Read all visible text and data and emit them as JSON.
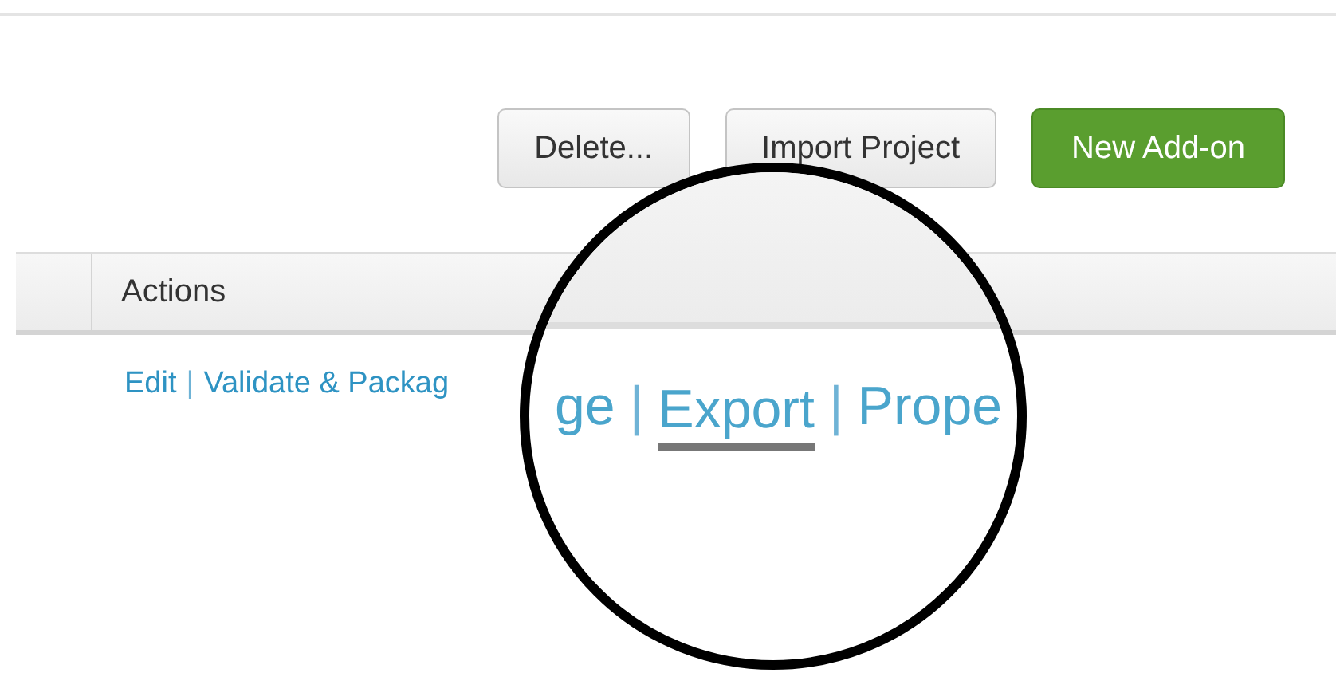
{
  "toolbar": {
    "buttons": [
      {
        "label": "Delete...",
        "kind": "default"
      },
      {
        "label": "Import Project",
        "kind": "default"
      },
      {
        "label": "New Add-on",
        "kind": "primary"
      }
    ]
  },
  "table": {
    "columns": [
      {
        "label": "Actions"
      }
    ],
    "row": {
      "items": [
        {
          "kind": "link",
          "text": "Edit"
        },
        {
          "kind": "separator",
          "text": "|"
        },
        {
          "kind": "link",
          "text": "Validate & Packag"
        }
      ]
    }
  },
  "magnifier": {
    "items": [
      {
        "kind": "link",
        "text": "ge",
        "hovered": false
      },
      {
        "kind": "separator",
        "text": "|"
      },
      {
        "kind": "link",
        "text": "Export",
        "hovered": true
      },
      {
        "kind": "separator",
        "text": "|"
      },
      {
        "kind": "link",
        "text": "Prope",
        "hovered": false
      }
    ]
  }
}
